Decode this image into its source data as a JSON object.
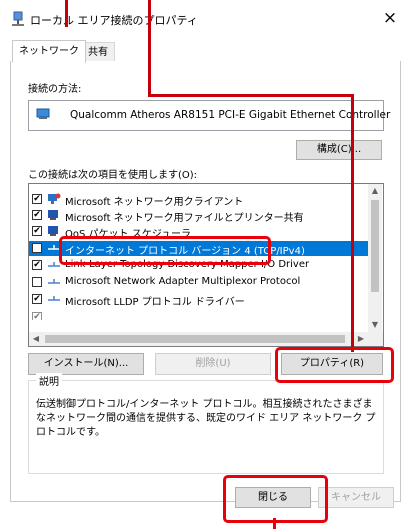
{
  "window": {
    "title": "ローカル エリア接続のプロパティ",
    "close_glyph": "×"
  },
  "tabs": [
    {
      "label": "ネットワーク"
    },
    {
      "label": "共有"
    }
  ],
  "connect_using": {
    "label": "接続の方法:",
    "adapter": "Qualcomm Atheros AR8151 PCI-E Gigabit Ethernet Controller",
    "configure_button": "構成(C)..."
  },
  "items_label": "この接続は次の項目を使用します(O):",
  "items": [
    {
      "label": "Microsoft ネットワーク用クライアント",
      "checked": true,
      "icon": "network-client-icon"
    },
    {
      "label": "Microsoft ネットワーク用ファイルとプリンター共有",
      "checked": true,
      "icon": "file-printer-share-icon"
    },
    {
      "label": "QoS パケット スケジューラ",
      "checked": true,
      "icon": "qos-icon"
    },
    {
      "label": "インターネット プロトコル バージョン 4 (TCP/IPv4)",
      "checked": true,
      "selected": true,
      "icon": "protocol-icon"
    },
    {
      "label": "Link-Layer Topology Discovery Mapper I/O Driver",
      "checked": true,
      "icon": "protocol-icon"
    },
    {
      "label": "Microsoft Network Adapter Multiplexor Protocol",
      "checked": false,
      "icon": "protocol-icon"
    },
    {
      "label": "Microsoft LLDP プロトコル ドライバー",
      "checked": true,
      "icon": "protocol-icon"
    }
  ],
  "buttons": {
    "install": "インストール(N)...",
    "uninstall": "削除(U)",
    "properties": "プロパティ(R)",
    "close": "閉じる",
    "cancel": "キャンセル"
  },
  "description": {
    "title": "説明",
    "text": "伝送制御プロトコル/インターネット プロトコル。相互接続されたさまざまなネットワーク間の通信を提供する、既定のワイド エリア ネットワーク プロトコルです。"
  },
  "colors": {
    "highlight_red": "#e8000b",
    "selection_blue": "#0078d7"
  }
}
